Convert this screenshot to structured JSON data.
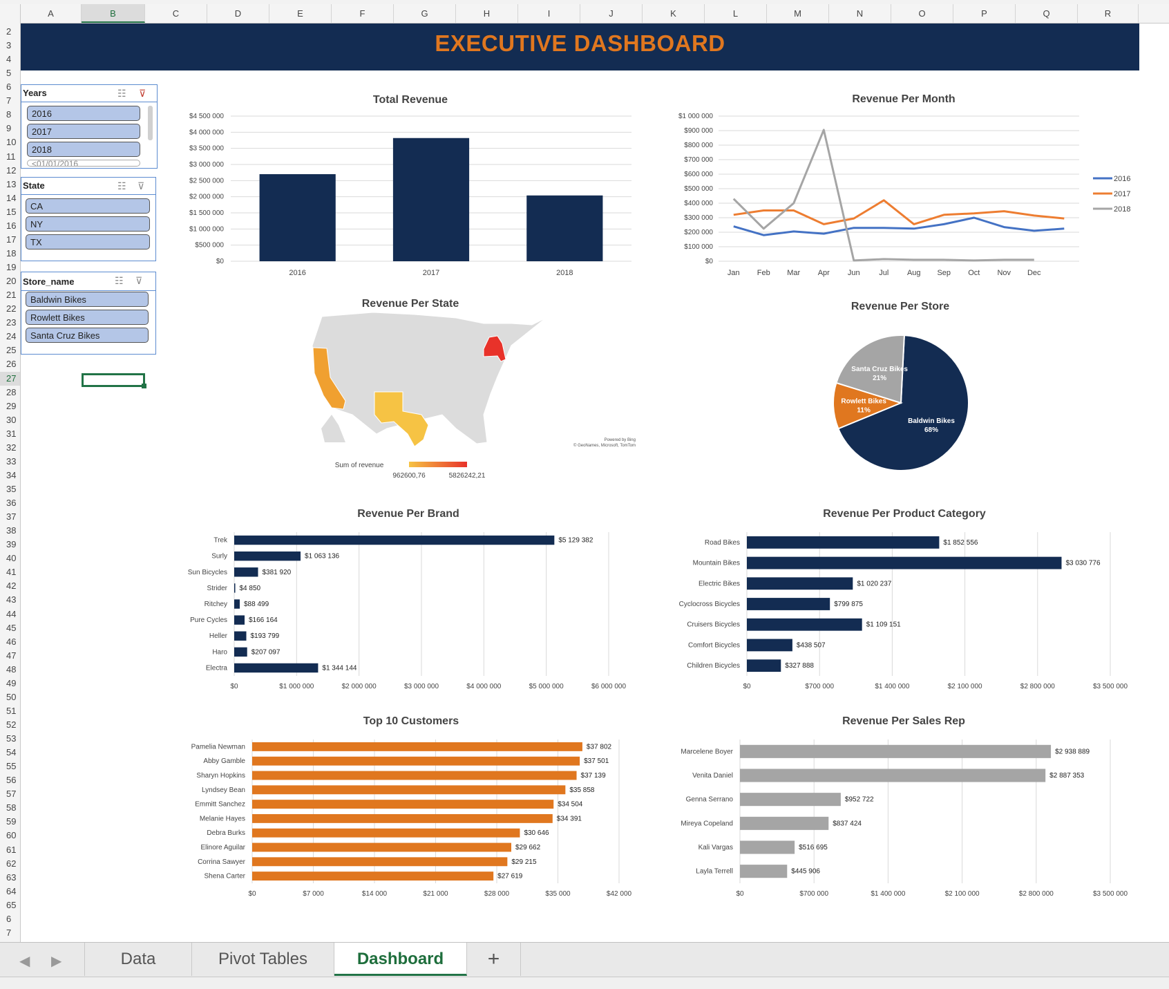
{
  "columns": [
    "A",
    "B",
    "C",
    "D",
    "E",
    "F",
    "G",
    "H",
    "I",
    "J",
    "K",
    "L",
    "M",
    "N",
    "O",
    "P",
    "Q",
    "R"
  ],
  "selected_column": "B",
  "rows": [
    "2",
    "3",
    "4",
    "5",
    "6",
    "7",
    "8",
    "9",
    "10",
    "11",
    "12",
    "13",
    "14",
    "15",
    "16",
    "17",
    "18",
    "19",
    "20",
    "21",
    "22",
    "23",
    "24",
    "25",
    "26",
    "27",
    "28",
    "29",
    "30",
    "31",
    "32",
    "33",
    "34",
    "35",
    "36",
    "37",
    "38",
    "39",
    "40",
    "41",
    "42",
    "43",
    "44",
    "45",
    "46",
    "47",
    "48",
    "49",
    "50",
    "51",
    "52",
    "53",
    "54",
    "55",
    "56",
    "57",
    "58",
    "59",
    "60",
    "61",
    "62",
    "63",
    "64",
    "65",
    "6",
    "7"
  ],
  "selected_row": "27",
  "banner": {
    "title": "EXECUTIVE DASHBOARD",
    "bg_color": "#132c52",
    "title_color": "#e0771f"
  },
  "slicers": {
    "years": {
      "header": "Years",
      "items": [
        "2016",
        "2017",
        "2018"
      ],
      "cut_item": "<01/01/2016"
    },
    "state": {
      "header": "State",
      "items": [
        "CA",
        "NY",
        "TX"
      ]
    },
    "store": {
      "header": "Store_name",
      "items": [
        "Baldwin Bikes",
        "Rowlett Bikes",
        "Santa Cruz Bikes"
      ]
    }
  },
  "tabs": {
    "data": "Data",
    "pivot": "Pivot Tables",
    "dashboard": "Dashboard",
    "add": "+",
    "active": "Dashboard"
  },
  "chart_data": [
    {
      "id": "total_revenue",
      "type": "bar",
      "title": "Total Revenue",
      "categories": [
        "2016",
        "2017",
        "2018"
      ],
      "values": [
        2700000,
        3820000,
        2040000
      ],
      "ylim": [
        0,
        4500000
      ],
      "yticks": [
        "$0",
        "$500 000",
        "$1 000 000",
        "$1 500 000",
        "$2 000 000",
        "$2 500 000",
        "$3 000 000",
        "$3 500 000",
        "$4 000 000",
        "$4 500 000"
      ],
      "color": "#132c52",
      "grid": true
    },
    {
      "id": "revenue_per_month",
      "type": "line",
      "title": "Revenue Per Month",
      "x": [
        "Jan",
        "Feb",
        "Mar",
        "Apr",
        "Jun",
        "Jul",
        "Aug",
        "Sep",
        "Oct",
        "Nov",
        "Dec"
      ],
      "ylim": [
        0,
        1000000
      ],
      "yticks": [
        "$0",
        "$100 000",
        "$200 000",
        "$300 000",
        "$400 000",
        "$500 000",
        "$600 000",
        "$700 000",
        "$800 000",
        "$900 000",
        "$1 000 000"
      ],
      "legend": "right",
      "series": [
        {
          "name": "2016",
          "color": "#4472c4",
          "values": [
            240000,
            180000,
            205000,
            190000,
            230000,
            230000,
            225000,
            255000,
            300000,
            235000,
            210000,
            225000
          ]
        },
        {
          "name": "2017",
          "color": "#ed7d31",
          "values": [
            320000,
            350000,
            350000,
            255000,
            295000,
            420000,
            255000,
            320000,
            330000,
            345000,
            315000,
            295000
          ]
        },
        {
          "name": "2018",
          "color": "#a5a5a5",
          "values": [
            430000,
            225000,
            400000,
            905000,
            5000,
            15000,
            10000,
            10000,
            5000,
            10000,
            10000,
            null
          ]
        }
      ],
      "grid": true
    },
    {
      "id": "revenue_per_state",
      "type": "map",
      "title": "Revenue Per State",
      "legend_label": "Sum of revenue",
      "min_label": "962600,76",
      "max_label": "5826242,21",
      "attribution": [
        "Powered by Bing",
        "© GeoNames, Microsoft, TomTom"
      ],
      "highlighted": [
        {
          "state": "CA",
          "color": "#f0a030"
        },
        {
          "state": "NY",
          "color": "#e8322a"
        },
        {
          "state": "TX",
          "color": "#f6c344"
        }
      ]
    },
    {
      "id": "revenue_per_store",
      "type": "pie",
      "title": "Revenue Per Store",
      "slices": [
        {
          "label": "Baldwin Bikes",
          "pct": "68%",
          "value": 68,
          "color": "#132c52"
        },
        {
          "label": "Rowlett Bikes",
          "pct": "11%",
          "value": 11,
          "color": "#e0771f"
        },
        {
          "label": "Santa Cruz Bikes",
          "pct": "21%",
          "value": 21,
          "color": "#a5a5a5"
        }
      ]
    },
    {
      "id": "revenue_per_brand",
      "type": "bar",
      "orientation": "horizontal",
      "title": "Revenue Per Brand",
      "categories": [
        "Trek",
        "Surly",
        "Sun Bicycles",
        "Strider",
        "Ritchey",
        "Pure Cycles",
        "Heller",
        "Haro",
        "Electra"
      ],
      "values": [
        5129382,
        1063136,
        381920,
        4850,
        88499,
        166164,
        193799,
        207097,
        1344144
      ],
      "labels": [
        "$5 129 382",
        "$1 063 136",
        "$381 920",
        "$4 850",
        "$88 499",
        "$166 164",
        "$193 799",
        "$207 097",
        "$1 344 144"
      ],
      "xlim": [
        0,
        6000000
      ],
      "xticks": [
        "$0",
        "$1 000 000",
        "$2 000 000",
        "$3 000 000",
        "$4 000 000",
        "$5 000 000",
        "$6 000 000"
      ],
      "color": "#132c52"
    },
    {
      "id": "revenue_per_category",
      "type": "bar",
      "orientation": "horizontal",
      "title": "Revenue Per Product Category",
      "categories": [
        "Road Bikes",
        "Mountain Bikes",
        "Electric Bikes",
        "Cyclocross Bicycles",
        "Cruisers Bicycles",
        "Comfort Bicycles",
        "Children Bicycles"
      ],
      "values": [
        1852556,
        3030776,
        1020237,
        799875,
        1109151,
        438507,
        327888
      ],
      "labels": [
        "$1 852 556",
        "$3 030 776",
        "$1 020 237",
        "$799 875",
        "$1 109 151",
        "$438 507",
        "$327 888"
      ],
      "xlim": [
        0,
        3500000
      ],
      "xticks": [
        "$0",
        "$700 000",
        "$1 400 000",
        "$2 100 000",
        "$2 800 000",
        "$3 500 000"
      ],
      "color": "#132c52"
    },
    {
      "id": "top_customers",
      "type": "bar",
      "orientation": "horizontal",
      "title": "Top 10 Customers",
      "categories": [
        "Pamelia Newman",
        "Abby Gamble",
        "Sharyn Hopkins",
        "Lyndsey Bean",
        "Emmitt Sanchez",
        "Melanie Hayes",
        "Debra Burks",
        "Elinore Aguilar",
        "Corrina Sawyer",
        "Shena Carter"
      ],
      "values": [
        37802,
        37501,
        37139,
        35858,
        34504,
        34391,
        30646,
        29662,
        29215,
        27619
      ],
      "labels": [
        "$37 802",
        "$37 501",
        "$37 139",
        "$35 858",
        "$34 504",
        "$34 391",
        "$30 646",
        "$29 662",
        "$29 215",
        "$27 619"
      ],
      "xlim": [
        0,
        42000
      ],
      "xticks": [
        "$0",
        "$7 000",
        "$14 000",
        "$21 000",
        "$28 000",
        "$35 000",
        "$42 000"
      ],
      "color": "#e0771f"
    },
    {
      "id": "revenue_per_rep",
      "type": "bar",
      "orientation": "horizontal",
      "title": "Revenue Per Sales Rep",
      "categories": [
        "Marcelene Boyer",
        "Venita Daniel",
        "Genna Serrano",
        "Mireya Copeland",
        "Kali Vargas",
        "Layla Terrell"
      ],
      "values": [
        2938889,
        2887353,
        952722,
        837424,
        516695,
        445906
      ],
      "labels": [
        "$2 938 889",
        "$2 887 353",
        "$952 722",
        "$837 424",
        "$516 695",
        "$445 906"
      ],
      "xlim": [
        0,
        3500000
      ],
      "xticks": [
        "$0",
        "$700 000",
        "$1 400 000",
        "$2 100 000",
        "$2 800 000",
        "$3 500 000"
      ],
      "color": "#a5a5a5"
    }
  ]
}
